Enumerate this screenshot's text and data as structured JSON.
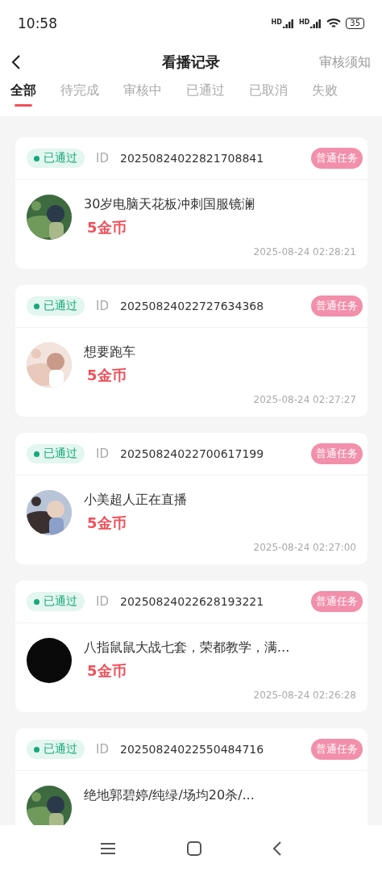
{
  "status_bar": {
    "time": "10:58",
    "network_labels": [
      "HD",
      "HD"
    ],
    "battery": "35"
  },
  "header": {
    "title": "看播记录",
    "action": "审核须知"
  },
  "tabs": [
    {
      "label": "全部",
      "selected": true
    },
    {
      "label": "待完成",
      "selected": false
    },
    {
      "label": "审核中",
      "selected": false
    },
    {
      "label": "已通过",
      "selected": false
    },
    {
      "label": "已取消",
      "selected": false
    },
    {
      "label": "失败",
      "selected": false
    }
  ],
  "records": [
    {
      "status": "已通过",
      "id_label": "ID",
      "id": "20250824022821708841",
      "tag": "普通任务",
      "title": "30岁电脑天花板冲刺国服镜澜",
      "reward": "5金币",
      "time": "2025-08-24 02:28:21"
    },
    {
      "status": "已通过",
      "id_label": "ID",
      "id": "20250824022727634368",
      "tag": "普通任务",
      "title": "想要跑车",
      "reward": "5金币",
      "time": "2025-08-24 02:27:27"
    },
    {
      "status": "已通过",
      "id_label": "ID",
      "id": "20250824022700617199",
      "tag": "普通任务",
      "title": "小美超人正在直播",
      "reward": "5金币",
      "time": "2025-08-24 02:27:00"
    },
    {
      "status": "已通过",
      "id_label": "ID",
      "id": "20250824022628193221",
      "tag": "普通任务",
      "title": "八指鼠鼠大战七套，荣都教学，满...",
      "reward": "5金币",
      "time": "2025-08-24 02:26:28",
      "avatar": {
        "kind": "plain"
      }
    },
    {
      "status": "已通过",
      "id_label": "ID",
      "id": "20250824022550484716",
      "tag": "普通任务",
      "title": "绝地郭碧婷/纯绿/场均20杀/..."
    }
  ]
}
